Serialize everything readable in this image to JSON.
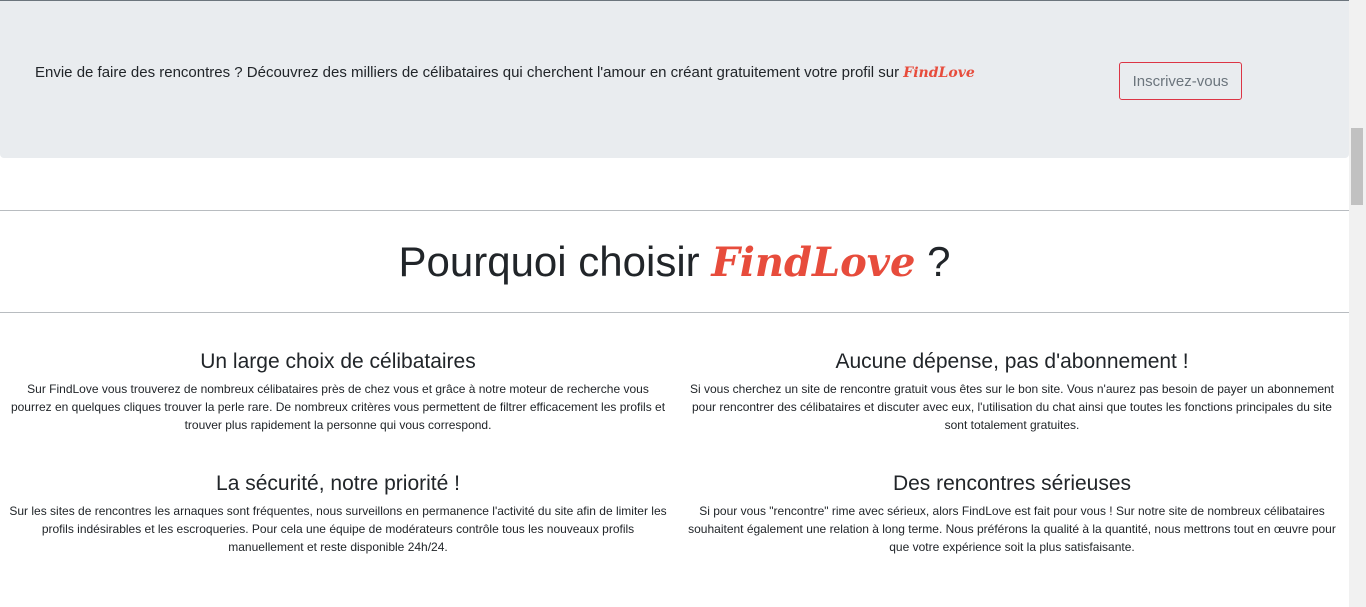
{
  "banner": {
    "text": "Envie de faire des rencontres ? Découvrez des milliers de célibataires qui cherchent l'amour en créant gratuitement votre profil sur ",
    "brand": "FindLove",
    "button_label": "Inscrivez-vous"
  },
  "why": {
    "title_prefix": "Pourquoi choisir ",
    "brand": "FindLove",
    "title_suffix": " ?"
  },
  "features": [
    {
      "title": "Un large choix de célibataires",
      "text": "Sur FindLove vous trouverez de nombreux célibataires près de chez vous et grâce à notre moteur de recherche vous pourrez en quelques cliques trouver la perle rare. De nombreux critères vous permettent de filtrer efficacement les profils et trouver plus rapidement la personne qui vous correspond."
    },
    {
      "title": "Aucune dépense, pas d'abonnement !",
      "text": "Si vous cherchez un site de rencontre gratuit vous êtes sur le bon site. Vous n'aurez pas besoin de payer un abonnement pour rencontrer des célibataires et discuter avec eux, l'utilisation du chat ainsi que toutes les fonctions principales du site sont totalement gratuites."
    },
    {
      "title": "La sécurité, notre priorité !",
      "text": "Sur les sites de rencontres les arnaques sont fréquentes, nous surveillons en permanence l'activité du site afin de limiter les profils indésirables et les escroqueries. Pour cela une équipe de modérateurs contrôle tous les nouveaux profils manuellement et reste disponible 24h/24."
    },
    {
      "title": "Des rencontres sérieuses",
      "text": "Si pour vous \"rencontre\" rime avec sérieux, alors FindLove est fait pour vous ! Sur notre site de nombreux célibataires souhaitent également une relation à long terme. Nous préférons la qualité à la quantité, nous mettrons tout en œuvre pour que votre expérience soit la plus satisfaisante."
    }
  ],
  "colors": {
    "brand": "#e74c3c",
    "banner_bg": "#e9ecef",
    "button_border": "#dc3545"
  }
}
